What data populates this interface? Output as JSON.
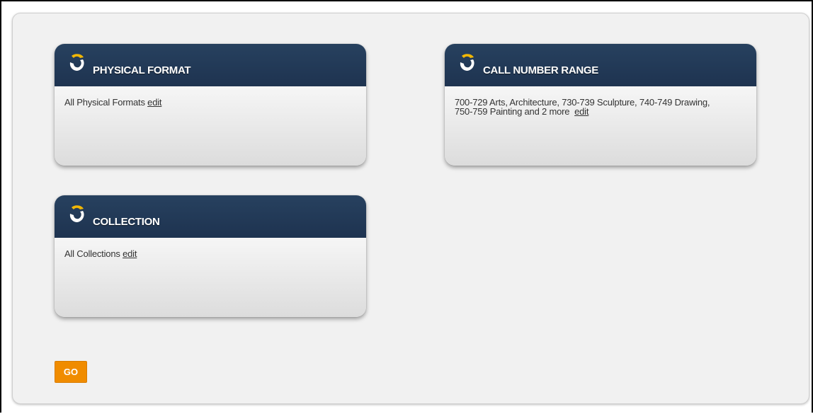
{
  "cards": {
    "physical_format": {
      "title": "PHYSICAL FORMAT",
      "summary": "All Physical Formats",
      "edit_label": "edit"
    },
    "call_number_range": {
      "title": "CALL NUMBER RANGE",
      "summary": "700-729 Arts, Architecture, 730-739 Sculpture, 740-749 Drawing, 750-759 Painting and 2 more",
      "edit_label": "edit"
    },
    "collection": {
      "title": "COLLECTION",
      "summary": "All Collections",
      "edit_label": "edit"
    }
  },
  "icons": {
    "card_logo": "swirl-logo-icon"
  },
  "go_button": {
    "label": "GO"
  },
  "colors": {
    "header_bg": "#1e3350",
    "go_button_bg": "#f08c00",
    "logo_yellow": "#f2b705",
    "panel_bg": "#f1f1f1"
  }
}
